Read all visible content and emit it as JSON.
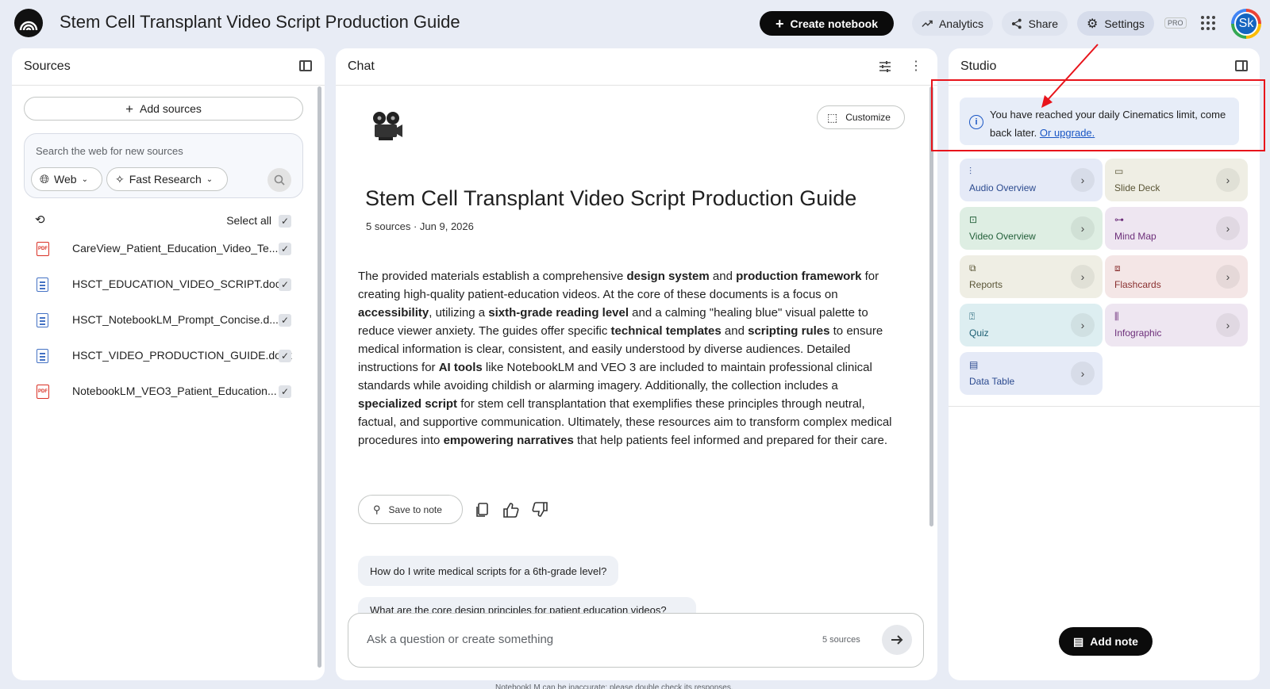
{
  "header": {
    "title": "Stem Cell Transplant Video Script Production Guide",
    "create_label": "Create notebook",
    "analytics_label": "Analytics",
    "share_label": "Share",
    "settings_label": "Settings",
    "pro_badge": "PRO",
    "avatar_initials": "Sk"
  },
  "sources": {
    "title": "Sources",
    "add_label": "Add sources",
    "search_placeholder": "Search the web for new sources",
    "web_chip": "Web",
    "fast_chip": "Fast Research",
    "select_all": "Select all",
    "items": [
      {
        "name": "CareView_Patient_Education_Video_Te...",
        "type": "pdf"
      },
      {
        "name": "HSCT_EDUCATION_VIDEO_SCRIPT.docx",
        "type": "doc"
      },
      {
        "name": "HSCT_NotebookLM_Prompt_Concise.d...",
        "type": "doc"
      },
      {
        "name": "HSCT_VIDEO_PRODUCTION_GUIDE.docx",
        "type": "doc"
      },
      {
        "name": "NotebookLM_VEO3_Patient_Education...",
        "type": "pdf"
      }
    ]
  },
  "chat": {
    "title": "Chat",
    "customize_label": "Customize",
    "notebook_title": "Stem Cell Transplant Video Script Production Guide",
    "meta": "5 sources · Jun 9, 2026",
    "summary_parts": [
      {
        "t": "The provided materials establish a comprehensive ",
        "b": false
      },
      {
        "t": "design system",
        "b": true
      },
      {
        "t": " and ",
        "b": false
      },
      {
        "t": "production framework",
        "b": true
      },
      {
        "t": " for creating high-quality patient-education videos. At the core of these documents is a focus on ",
        "b": false
      },
      {
        "t": "accessibility",
        "b": true
      },
      {
        "t": ", utilizing a ",
        "b": false
      },
      {
        "t": "sixth-grade reading level",
        "b": true
      },
      {
        "t": " and a calming \"healing blue\" visual palette to reduce viewer anxiety. The guides offer specific ",
        "b": false
      },
      {
        "t": "technical templates",
        "b": true
      },
      {
        "t": " and ",
        "b": false
      },
      {
        "t": "scripting rules",
        "b": true
      },
      {
        "t": " to ensure medical information is clear, consistent, and easily understood by diverse audiences. Detailed instructions for ",
        "b": false
      },
      {
        "t": "AI tools",
        "b": true
      },
      {
        "t": " like NotebookLM and VEO 3 are included to maintain professional clinical standards while avoiding childish or alarming imagery. Additionally, the collection includes a ",
        "b": false
      },
      {
        "t": "specialized script",
        "b": true
      },
      {
        "t": " for stem cell transplantation that exemplifies these principles through neutral, factual, and supportive communication. Ultimately, these resources aim to transform complex medical procedures into ",
        "b": false
      },
      {
        "t": "empowering narratives",
        "b": true
      },
      {
        "t": " that help patients feel informed and prepared for their care.",
        "b": false
      }
    ],
    "save_note_label": "Save to note",
    "suggestion_1": "How do I write medical scripts for a 6th-grade level?",
    "suggestion_2": "What are the core design principles for patient education videos?",
    "composer_placeholder": "Ask a question or create something",
    "composer_sources": "5 sources",
    "disclaimer": "NotebookLM can be inaccurate; please double check its responses."
  },
  "studio": {
    "title": "Studio",
    "limit_text": "You have reached your daily Cinematics limit, come back later.",
    "limit_link": "Or upgrade.",
    "tiles": [
      {
        "label": "Audio Overview",
        "icon": "audio-wave-icon",
        "glyph": "⫶",
        "color": "blue"
      },
      {
        "label": "Slide Deck",
        "icon": "slides-icon",
        "glyph": "▭",
        "color": "sand"
      },
      {
        "label": "Video Overview",
        "icon": "video-icon",
        "glyph": "⊡",
        "color": "green"
      },
      {
        "label": "Mind Map",
        "icon": "mind-map-icon",
        "glyph": "⊶",
        "color": "purple"
      },
      {
        "label": "Reports",
        "icon": "reports-icon",
        "glyph": "⧉",
        "color": "sand"
      },
      {
        "label": "Flashcards",
        "icon": "flashcards-icon",
        "glyph": "⧈",
        "color": "rose"
      },
      {
        "label": "Quiz",
        "icon": "quiz-icon",
        "glyph": "⍰",
        "color": "cyan"
      },
      {
        "label": "Infographic",
        "icon": "infographic-icon",
        "glyph": "⫼",
        "color": "purple"
      },
      {
        "label": "Data Table",
        "icon": "data-table-icon",
        "glyph": "▤",
        "color": "blue"
      }
    ],
    "add_note_label": "Add note"
  },
  "colors": {
    "background": "#e8ecf5",
    "highlight_red": "#e8141b",
    "link_blue": "#1a56c4"
  }
}
